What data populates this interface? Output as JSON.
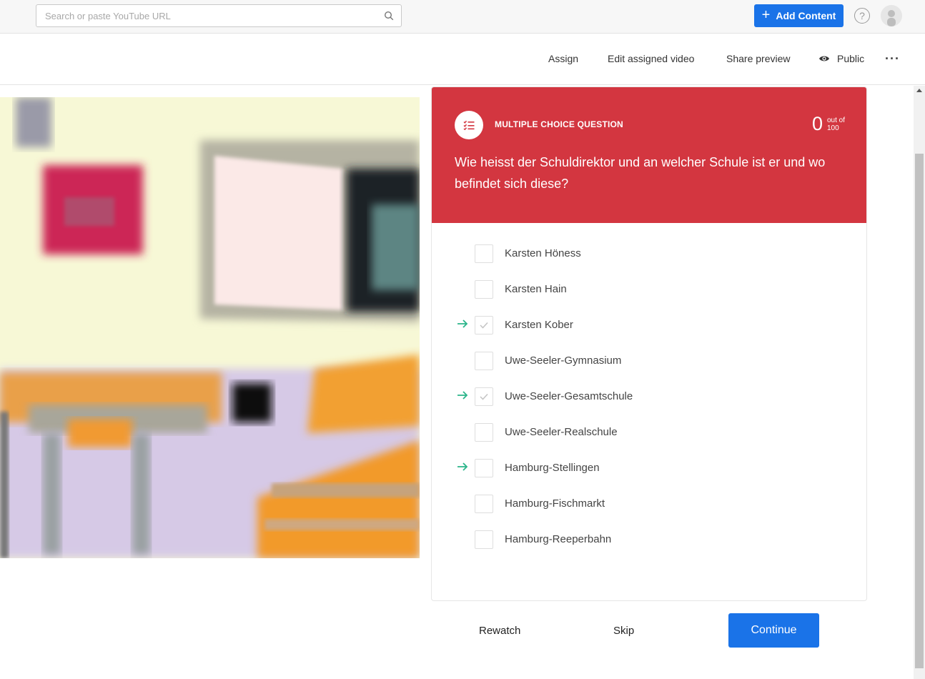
{
  "search": {
    "placeholder": "Search or paste YouTube URL",
    "icon": "search-icon"
  },
  "header": {
    "add_content_label": "Add Content",
    "accent": "#1a73e8"
  },
  "actions": {
    "assign": "Assign",
    "edit_assigned": "Edit assigned video",
    "share_preview": "Share preview",
    "public": "Public"
  },
  "question": {
    "type_label": "MULTIPLE CHOICE QUESTION",
    "score": "0",
    "score_out_of": "out of",
    "score_max": "100",
    "text": "Wie heisst der Schuldirektor und an welcher Schule ist er und wo befindet sich diese?",
    "header_color": "#d33640",
    "options": [
      {
        "label": "Karsten Höness",
        "arrow": false,
        "checked": false
      },
      {
        "label": "Karsten Hain",
        "arrow": false,
        "checked": false
      },
      {
        "label": "Karsten Kober",
        "arrow": true,
        "checked": true
      },
      {
        "label": "Uwe-Seeler-Gymnasium",
        "arrow": false,
        "checked": false
      },
      {
        "label": "Uwe-Seeler-Gesamtschule",
        "arrow": true,
        "checked": true
      },
      {
        "label": "Uwe-Seeler-Realschule",
        "arrow": false,
        "checked": false
      },
      {
        "label": "Hamburg-Stellingen",
        "arrow": true,
        "checked": false
      },
      {
        "label": "Hamburg-Fischmarkt",
        "arrow": false,
        "checked": false
      },
      {
        "label": "Hamburg-Reeperbahn",
        "arrow": false,
        "checked": false
      }
    ]
  },
  "footer": {
    "rewatch": "Rewatch",
    "skip": "Skip",
    "continue": "Continue"
  }
}
